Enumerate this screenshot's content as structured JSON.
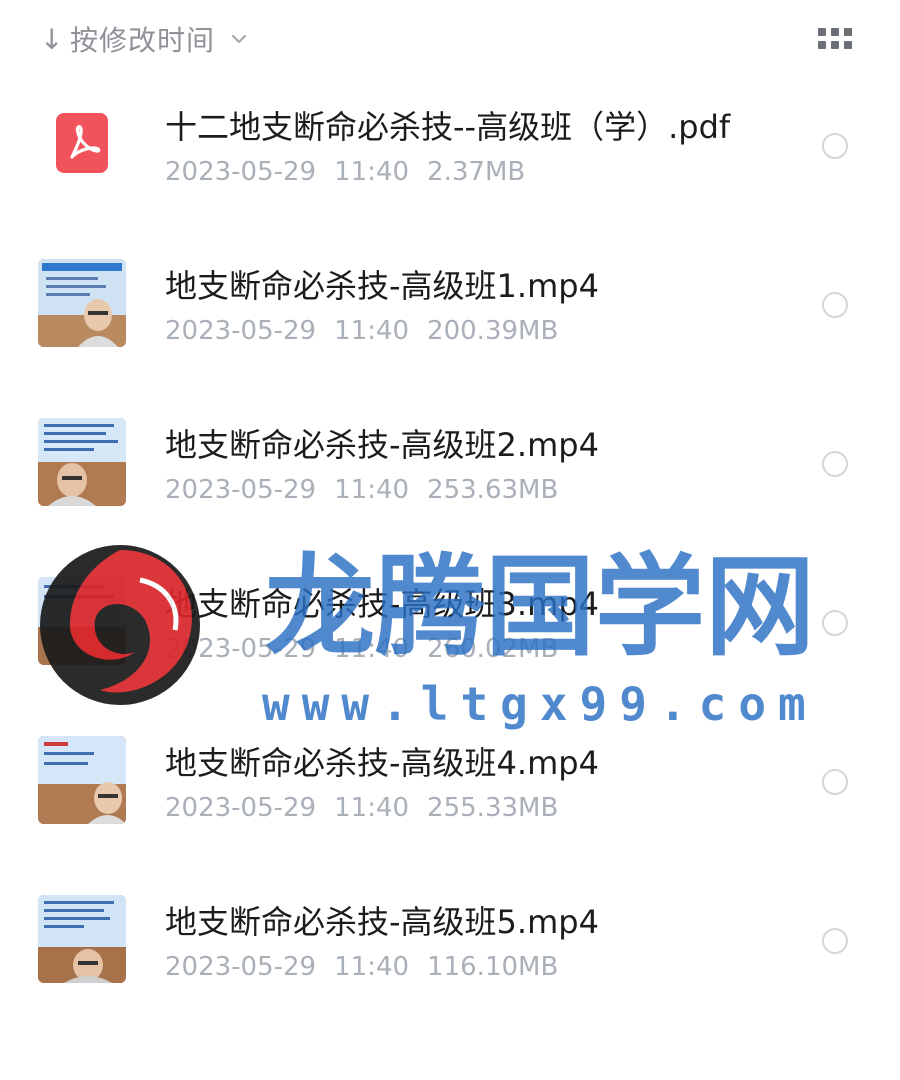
{
  "toolbar": {
    "sort_label": "按修改时间",
    "sort_icon": "arrow-down-icon",
    "sort_dropdown_icon": "chevron-down-icon",
    "view_toggle_icon": "grid-view-icon"
  },
  "files": [
    {
      "name": "十二地支断命必杀技--高级班（学）.pdf",
      "date": "2023-05-29",
      "time": "11:40",
      "size": "2.37MB",
      "type": "pdf",
      "icon": "pdf-icon"
    },
    {
      "name": "地支断命必杀技-高级班1.mp4",
      "date": "2023-05-29",
      "time": "11:40",
      "size": "200.39MB",
      "type": "video",
      "icon": "video-thumbnail"
    },
    {
      "name": "地支断命必杀技-高级班2.mp4",
      "date": "2023-05-29",
      "time": "11:40",
      "size": "253.63MB",
      "type": "video",
      "icon": "video-thumbnail"
    },
    {
      "name": "地支断命必杀技-高级班3.mp4",
      "date": "2023-05-29",
      "time": "11:40",
      "size": "260.02MB",
      "type": "video",
      "icon": "video-thumbnail"
    },
    {
      "name": "地支断命必杀技-高级班4.mp4",
      "date": "2023-05-29",
      "time": "11:40",
      "size": "255.33MB",
      "type": "video",
      "icon": "video-thumbnail"
    },
    {
      "name": "地支断命必杀技-高级班5.mp4",
      "date": "2023-05-29",
      "time": "11:40",
      "size": "116.10MB",
      "type": "video",
      "icon": "video-thumbnail"
    }
  ],
  "watermark": {
    "title": "龙腾国学网",
    "url": "www.ltgx99.com"
  },
  "colors": {
    "pdf_red": "#f0535c",
    "watermark_blue": "#2a6fc2",
    "meta_gray": "#aab0b7"
  }
}
